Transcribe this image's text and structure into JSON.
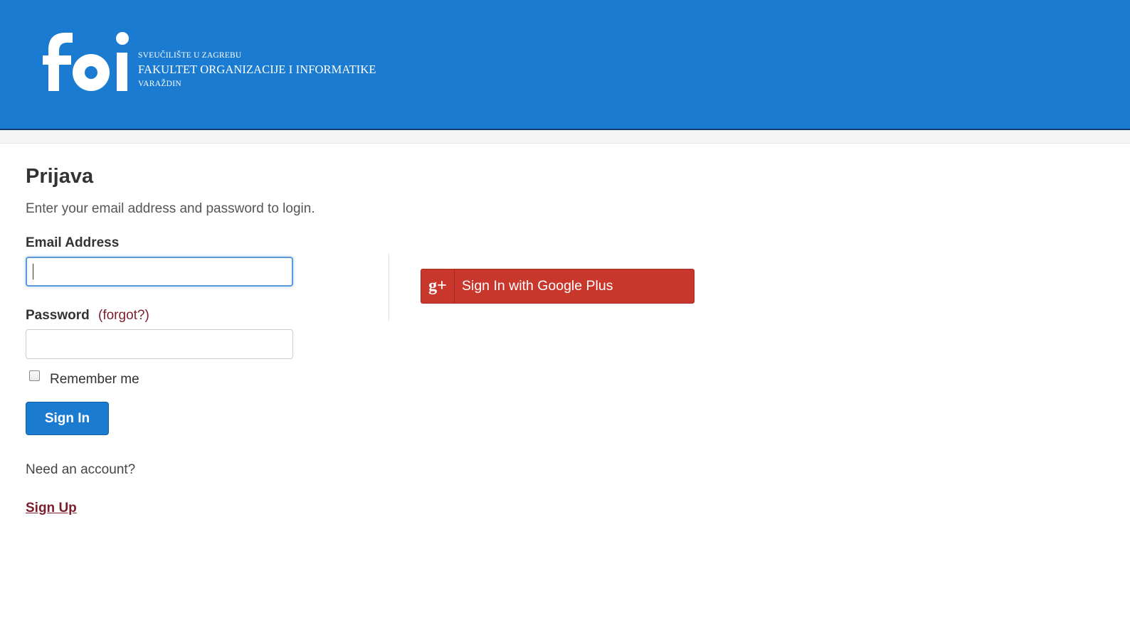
{
  "header": {
    "logo": {
      "mark": "foi",
      "line1": "SVEUČILIŠTE U ZAGREBU",
      "line2": "FAKULTET ORGANIZACIJE I INFORMATIKE",
      "line3": "VARAŽDIN"
    },
    "background_color": "#1a7bd0"
  },
  "login": {
    "title": "Prijava",
    "subtitle": "Enter your email address and password to login.",
    "email_label": "Email Address",
    "email_value": "",
    "password_label": "Password",
    "forgot_label": "(forgot?)",
    "password_value": "",
    "remember_label": "Remember me",
    "remember_checked": false,
    "signin_label": "Sign In",
    "need_account": "Need an account?",
    "signup_label": "Sign Up"
  },
  "social": {
    "google_icon": "g+",
    "google_label": "Sign In with Google Plus",
    "google_color": "#c9372c"
  },
  "colors": {
    "accent": "#1a7bd0",
    "link": "#7a1e2d"
  }
}
